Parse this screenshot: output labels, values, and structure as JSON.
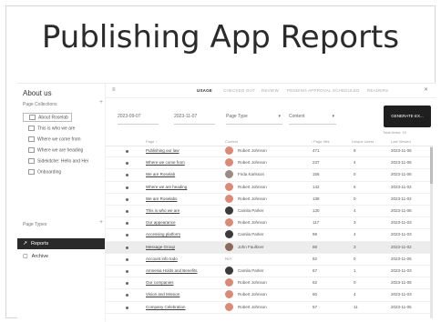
{
  "hero_title": "Publishing App Reports",
  "sidebar": {
    "title": "About us",
    "section_label": "Page Collections",
    "add_symbol": "+",
    "tree": [
      {
        "label": "About Roselab",
        "boxed": true
      },
      {
        "label": "This is who we are",
        "boxed": false
      },
      {
        "label": "Where we come from",
        "boxed": false
      },
      {
        "label": "Where we are heading",
        "boxed": false
      },
      {
        "label": "Sidekitche: Hello and Hei",
        "boxed": false
      },
      {
        "label": "Onboarding",
        "boxed": false
      }
    ],
    "page_types_label": "Page Types",
    "nav": [
      {
        "label": "Reports",
        "icon": "↗",
        "active": true
      },
      {
        "label": "Archive",
        "icon": "▢",
        "active": false
      }
    ]
  },
  "tabs": {
    "menu_icon": "≡",
    "close_icon": "✕",
    "items": [
      {
        "label": "USAGE",
        "active": true
      },
      {
        "label": "CHECKED OUT",
        "active": false
      },
      {
        "label": "REVIEW",
        "active": false
      },
      {
        "label": "PENDING APPROVAL",
        "active": false
      },
      {
        "label": "SCHEDULED",
        "active": false
      },
      {
        "label": "READERS",
        "active": false
      }
    ]
  },
  "filters": {
    "date_from": "2023-09-07",
    "date_to": "2023-11-07",
    "page_type": "Page Type",
    "content": "Content",
    "caret": "▾"
  },
  "generate_button": "GENERATE EX...",
  "total_label": "Total items: 19",
  "table": {
    "headers": [
      "Page ↑",
      "Content",
      "↓ Page Hits",
      "Unique Users",
      "Last Viewed"
    ],
    "rows": [
      {
        "page": "Publishing our law",
        "author": "Robert Johnson",
        "av": "re",
        "hits": "471",
        "users": "9",
        "last": "2023-11-06",
        "hl": false
      },
      {
        "page": "Where we come from",
        "author": "Robert Johnson",
        "av": "re",
        "hits": "237",
        "users": "4",
        "last": "2023-11-05",
        "hl": false
      },
      {
        "page": "We are Roselab",
        "author": "Frida Karlsson",
        "av": "fk",
        "hits": "156",
        "users": "0",
        "last": "2023-11-06",
        "hl": false
      },
      {
        "page": "Where we are heading",
        "author": "Robert Johnson",
        "av": "re",
        "hits": "142",
        "users": "6",
        "last": "2023-11-02",
        "hl": false
      },
      {
        "page": "We are Roselabs",
        "author": "Robert Johnson",
        "av": "re",
        "hits": "138",
        "users": "0",
        "last": "2023-11-02",
        "hl": false
      },
      {
        "page": "This is who we are",
        "author": "Camila Parker",
        "av": "cp",
        "hits": "130",
        "users": "4",
        "last": "2023-11-06",
        "hl": false
      },
      {
        "page": "Our appearance",
        "author": "Robert Johnson",
        "av": "re",
        "hits": "117",
        "users": "3",
        "last": "2023-11-03",
        "hl": false
      },
      {
        "page": "Accessing platform",
        "author": "Camila Parker",
        "av": "cp",
        "hits": "99",
        "users": "4",
        "last": "2023-11-03",
        "hl": false
      },
      {
        "page": "Message Group",
        "author": "John Faulkner",
        "av": "jf",
        "hits": "88",
        "users": "3",
        "last": "2023-11-02",
        "hl": true
      },
      {
        "page": "Account info todo",
        "author": "",
        "rev": "N/A",
        "av": "",
        "hits": "82",
        "users": "0",
        "last": "2023-11-05",
        "hl": false
      },
      {
        "page": "Amnesia Holds and Benefits",
        "author": "Camila Parker",
        "av": "cp",
        "hits": "67",
        "users": "1",
        "last": "2023-11-03",
        "hl": false
      },
      {
        "page": "Our companies",
        "author": "Robert Johnson",
        "av": "re",
        "hits": "62",
        "users": "0",
        "last": "2023-11-05",
        "hl": false
      },
      {
        "page": "Vision and Mission",
        "author": "Robert Johnson",
        "av": "re",
        "hits": "60",
        "users": "4",
        "last": "2023-11-03",
        "hl": false
      },
      {
        "page": "Company Celebration",
        "author": "Robert Johnson",
        "av": "re",
        "hits": "57",
        "users": "11",
        "last": "2023-11-05",
        "hl": false
      }
    ]
  }
}
